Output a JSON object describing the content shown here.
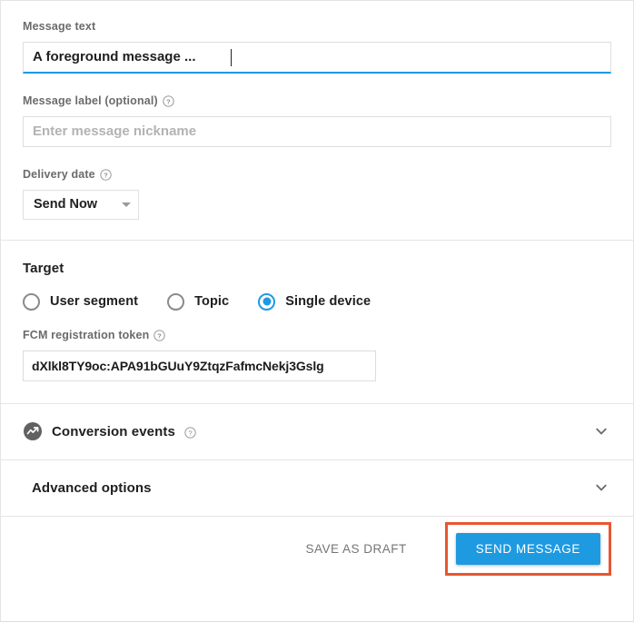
{
  "form": {
    "message_text": {
      "label": "Message text",
      "value": "A foreground message ...",
      "has_help": false
    },
    "message_label": {
      "label": "Message label (optional)",
      "value": "",
      "placeholder": "Enter message nickname",
      "has_help": true
    },
    "delivery_date": {
      "label": "Delivery date",
      "selected": "Send Now",
      "options": [
        "Send Now"
      ],
      "has_help": true
    }
  },
  "target": {
    "title": "Target",
    "options": [
      {
        "label": "User segment",
        "checked": false
      },
      {
        "label": "Topic",
        "checked": false
      },
      {
        "label": "Single device",
        "checked": true
      }
    ],
    "token_field": {
      "label": "FCM registration token",
      "value": "dXlkl8TY9oc:APA91bGUuY9ZtqzFafmcNekj3Gslg",
      "has_help": true
    }
  },
  "collapsibles": [
    {
      "title": "Conversion events",
      "has_help": true,
      "icon": "analytics-circle-icon",
      "expanded": false
    },
    {
      "title": "Advanced options",
      "has_help": false,
      "icon": null,
      "expanded": false
    }
  ],
  "footer": {
    "save_draft_label": "SAVE AS DRAFT",
    "send_label": "SEND MESSAGE"
  },
  "colors": {
    "accent_blue": "#1e9ae0",
    "focus_underline": "#039be5",
    "highlight_box": "#e8562f",
    "label_gray": "#6b6b6b",
    "divider": "#e6e6e6"
  }
}
